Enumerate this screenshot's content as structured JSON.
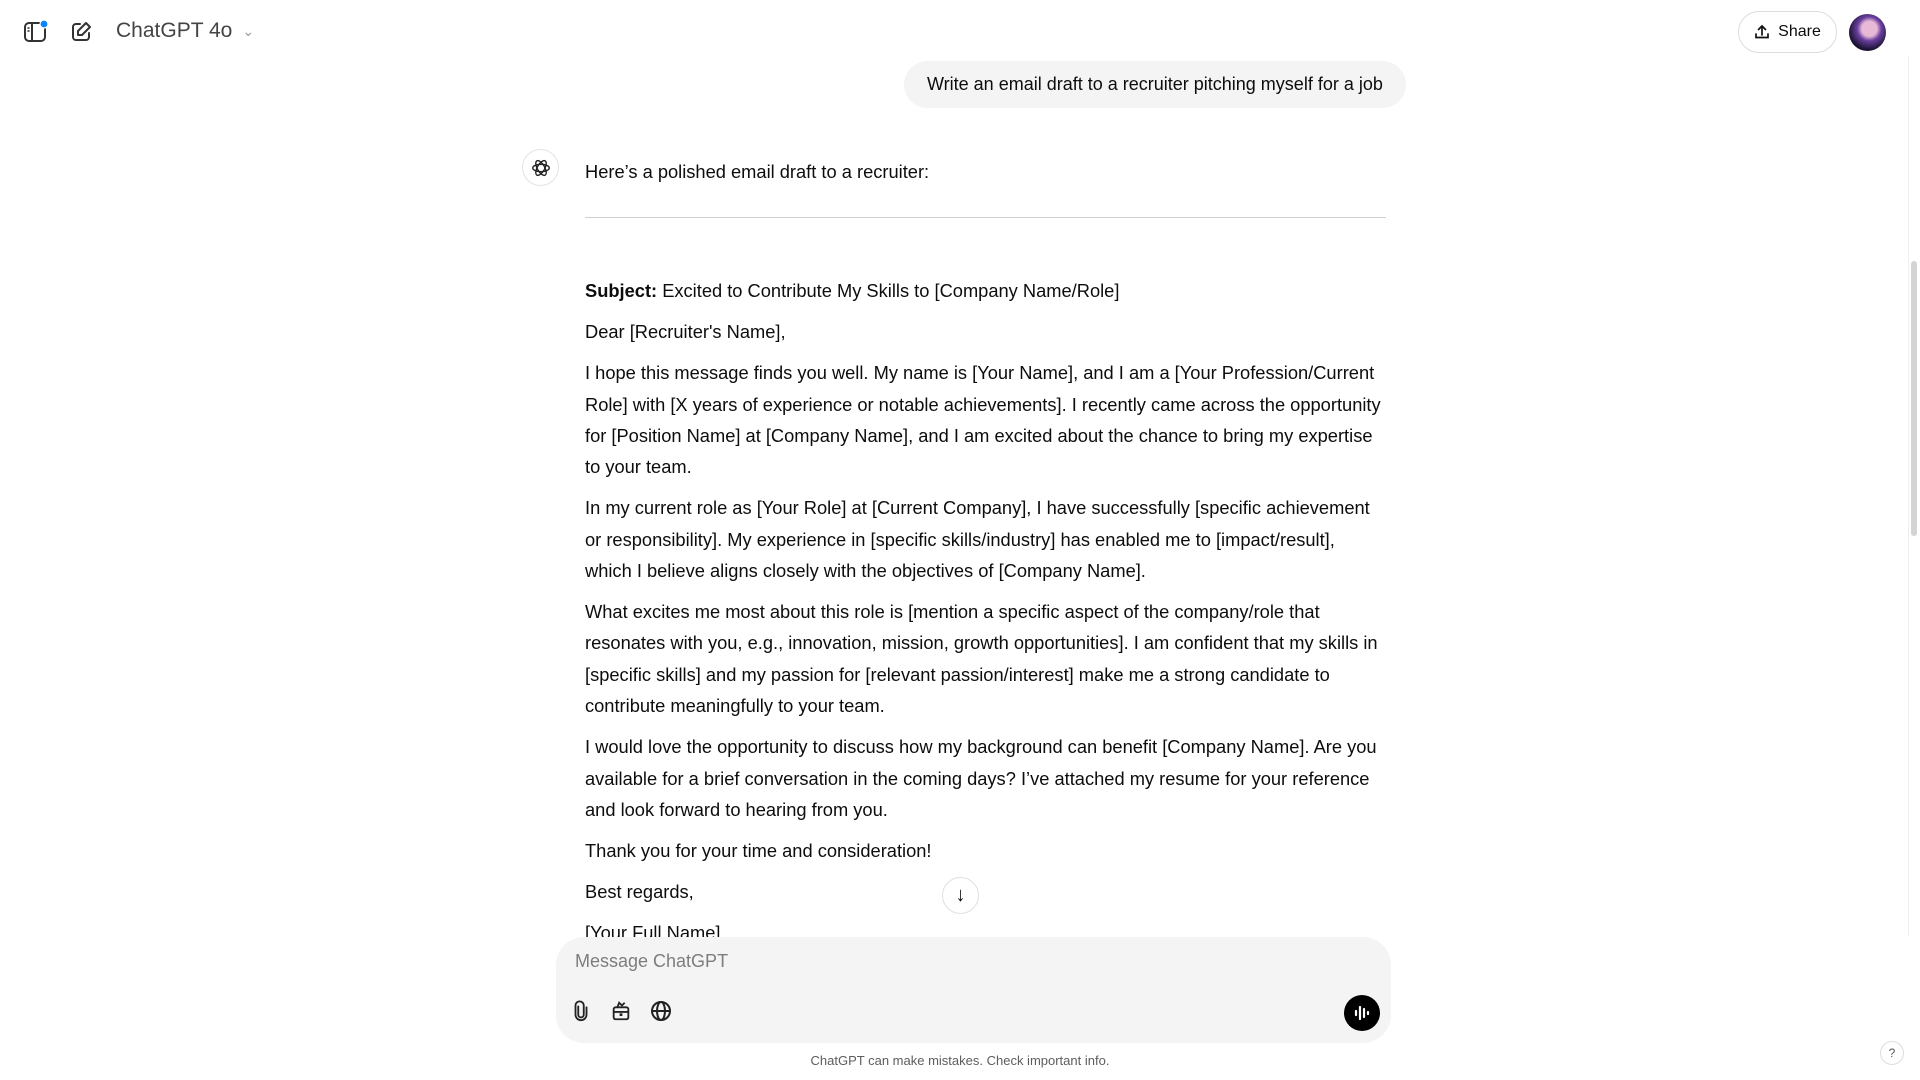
{
  "header": {
    "model_title": "ChatGPT 4o",
    "share_label": "Share",
    "icons": [
      "sidebar-icon",
      "new-chat-icon",
      "chevron-down-icon",
      "share-icon"
    ],
    "notification_color": "#0a84ff"
  },
  "conversation": {
    "user_message": "Write an email draft to a recruiter pitching myself for a job",
    "assistant_intro": "Here’s a polished email draft to a recruiter:",
    "subject_label": "Subject:",
    "subject_text": " Excited to Contribute My Skills to [Company Name/Role]",
    "paragraphs": [
      "Dear [Recruiter's Name],",
      "I hope this message finds you well. My name is [Your Name], and I am a [Your Profession/Current Role] with [X years of experience or notable achievements]. I recently came across the opportunity for [Position Name] at [Company Name], and I am excited about the chance to bring my expertise to your team.",
      "In my current role as [Your Role] at [Current Company], I have successfully [specific achievement or responsibility]. My experience in [specific skills/industry] has enabled me to [impact/result], which I believe aligns closely with the objectives of [Company Name].",
      "What excites me most about this role is [mention a specific aspect of the company/role that resonates with you, e.g., innovation, mission, growth opportunities]. I am confident that my skills in [specific skills] and my passion for [relevant passion/interest] make me a strong candidate to contribute meaningfully to your team.",
      "I would love the opportunity to discuss how my background can benefit [Company Name]. Are you available for a brief conversation in the coming days? I’ve attached my resume for your reference and look forward to hearing from you.",
      "Thank you for your time and consideration!",
      "Best regards,",
      "[Your Full Name]"
    ]
  },
  "composer": {
    "placeholder": "Message ChatGPT",
    "value": ""
  },
  "footer": {
    "disclaimer": "ChatGPT can make mistakes. Check important info.",
    "help_label": "?"
  }
}
